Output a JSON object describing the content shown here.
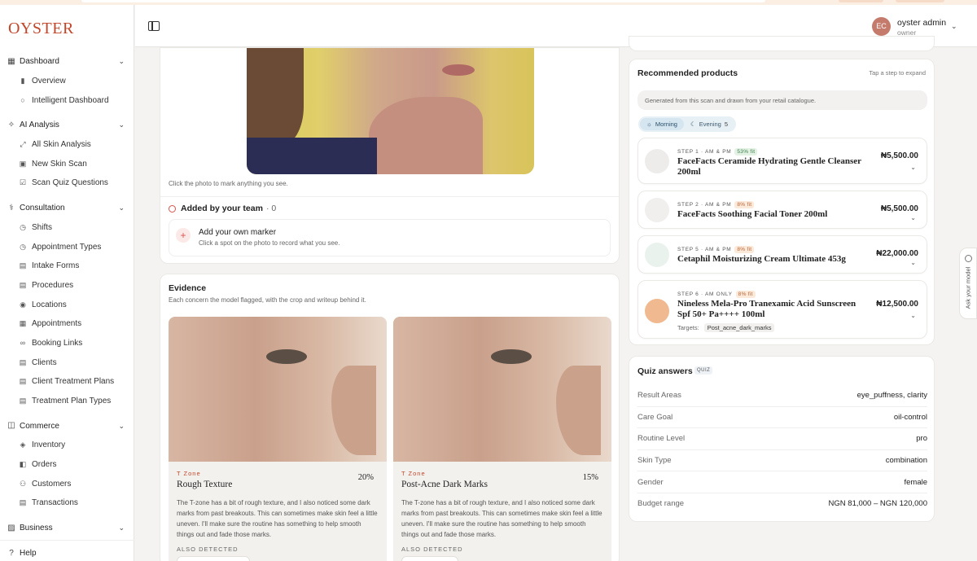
{
  "brand": "OYSTER",
  "user": {
    "initials": "EC",
    "name": "oyster admin",
    "role": "owner"
  },
  "nav": {
    "dashboard": {
      "label": "Dashboard",
      "items": [
        "Overview",
        "Intelligent Dashboard"
      ]
    },
    "ai": {
      "label": "AI Analysis",
      "items": [
        "All Skin Analysis",
        "New Skin Scan",
        "Scan Quiz Questions"
      ]
    },
    "consultation": {
      "label": "Consultation",
      "items": [
        "Shifts",
        "Appointment Types",
        "Intake Forms",
        "Procedures",
        "Locations",
        "Appointments",
        "Booking Links",
        "Clients",
        "Client Treatment Plans",
        "Treatment Plan Types"
      ]
    },
    "commerce": {
      "label": "Commerce",
      "items": [
        "Inventory",
        "Orders",
        "Customers",
        "Transactions"
      ]
    },
    "business": {
      "label": "Business"
    },
    "help": "Help"
  },
  "photo": {
    "caption": "Click the photo to mark anything you see.",
    "added_title": "Added by your team",
    "added_count": "· 0",
    "marker_title": "Add your own marker",
    "marker_sub": "Click a spot on the photo to record what you see."
  },
  "evidence": {
    "title": "Evidence",
    "subtitle": "Each concern the model flagged, with the crop and writeup behind it.",
    "items": [
      {
        "zone": "T Zone",
        "name": "Rough Texture",
        "pct": "20%",
        "desc": "The T-zone has a bit of rough texture, and I also noticed some dark marks from past breakouts. This can sometimes make skin feel a little uneven. I'll make sure the routine has something to help smooth things out and fade those marks.",
        "also": "ALSO DETECTED"
      },
      {
        "zone": "T Zone",
        "name": "Post-Acne Dark Marks",
        "pct": "15%",
        "desc": "The T-zone has a bit of rough texture, and I also noticed some dark marks from past breakouts. This can sometimes make skin feel a little uneven. I'll make sure the routine has something to help smooth things out and fade those marks.",
        "also": "ALSO DETECTED"
      }
    ]
  },
  "recommended": {
    "title": "Recommended products",
    "hint": "Tap a step to expand",
    "generated": "Generated from this scan and drawn from your retail catalogue.",
    "tabs": [
      {
        "label": "Morning",
        "count": ""
      },
      {
        "label": "Evening",
        "count": "5"
      }
    ],
    "products": [
      {
        "step": "STEP 1 · AM & PM",
        "fit": "53% fit",
        "name": "FaceFacts Ceramide Hydrating Gentle Cleanser 200ml",
        "price": "₦5,500.00"
      },
      {
        "step": "STEP 2 · AM & PM",
        "fit": "8% fit",
        "name": "FaceFacts Soothing Facial Toner 200ml",
        "price": "₦5,500.00"
      },
      {
        "step": "STEP 5 · AM & PM",
        "fit": "8% fit",
        "name": "Cetaphil Moisturizing Cream Ultimate 453g",
        "price": "₦22,000.00"
      },
      {
        "step": "STEP 6 · AM ONLY",
        "fit": "8% fit",
        "name": "Nineless Mela-Pro Tranexamic Acid Sunscreen Spf 50+ Pa++++ 100ml",
        "price": "₦12,500.00",
        "targets_label": "Targets:",
        "target": "Post_acne_dark_marks"
      }
    ]
  },
  "quiz": {
    "title": "Quiz answers",
    "badge": "QUIZ",
    "rows": [
      {
        "label": "Result Areas",
        "value": "eye_puffness, clarity"
      },
      {
        "label": "Care Goal",
        "value": "oil-control"
      },
      {
        "label": "Routine Level",
        "value": "pro"
      },
      {
        "label": "Skin Type",
        "value": "combination"
      },
      {
        "label": "Gender",
        "value": "female"
      },
      {
        "label": "Budget range",
        "value": "NGN 81,000 – NGN 120,000"
      }
    ]
  },
  "ask_model": "Ask your model",
  "colors": {
    "brand": "#c2462a",
    "fit_good": "#3c7d4a",
    "fit_low": "#b8663a"
  }
}
